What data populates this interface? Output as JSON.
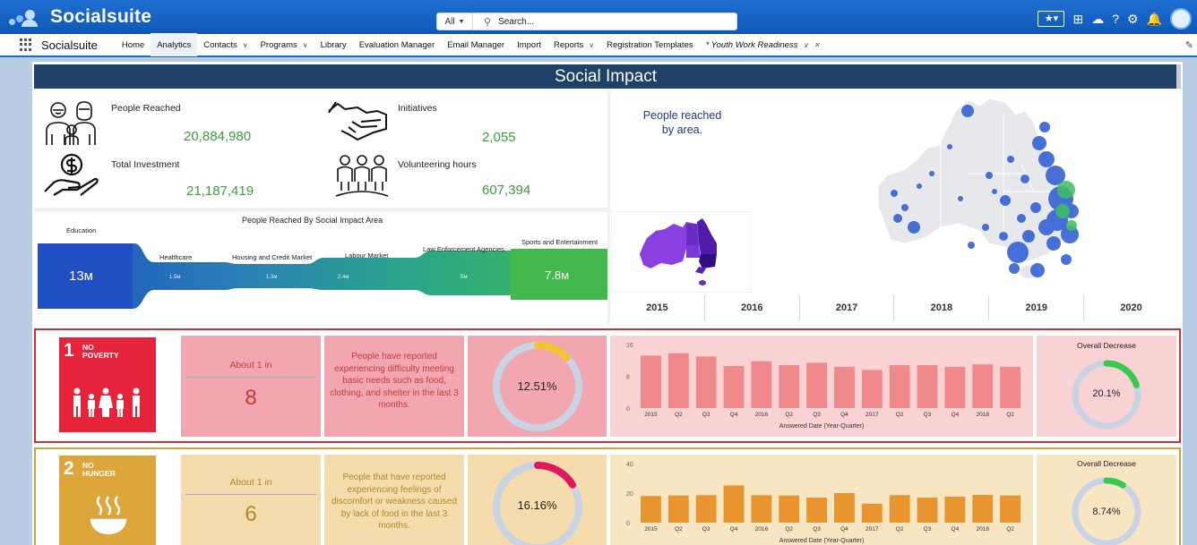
{
  "header": {
    "brand": "Socialsuite",
    "search_scope": "All",
    "search_placeholder": "Search..."
  },
  "nav": {
    "app_name": "Socialsuite",
    "items": [
      {
        "label": "Home",
        "dropdown": false
      },
      {
        "label": "Analytics",
        "dropdown": false,
        "active": true
      },
      {
        "label": "Contacts",
        "dropdown": true
      },
      {
        "label": "Programs",
        "dropdown": true
      },
      {
        "label": "Library",
        "dropdown": false
      },
      {
        "label": "Evaluation Manager",
        "dropdown": false
      },
      {
        "label": "Email Manager",
        "dropdown": false
      },
      {
        "label": "Import",
        "dropdown": false
      },
      {
        "label": "Reports",
        "dropdown": true
      },
      {
        "label": "Registration Templates",
        "dropdown": false
      }
    ],
    "open_tab": "* Youth Work Readiness"
  },
  "dashboard": {
    "title": "Social Impact",
    "metrics": {
      "people_reached": {
        "label": "People Reached",
        "value": "20,884,980"
      },
      "initiatives": {
        "label": "Initiatives",
        "value": "2,055"
      },
      "total_investment": {
        "label": "Total Investment",
        "value": "21,187,419"
      },
      "volunteering_hours": {
        "label": "Volunteering hours",
        "value": "607,394"
      }
    },
    "flow": {
      "title": "People Reached By Social Impact Area",
      "areas": [
        {
          "name": "Education",
          "value": "13м"
        },
        {
          "name": "Healthcare",
          "value": "1.5м"
        },
        {
          "name": "Housing and Credit Market",
          "value": "1.3м"
        },
        {
          "name": "Labour Market",
          "value": "2.4м"
        },
        {
          "name": "Law Enforcement Agencies",
          "value": "5м"
        },
        {
          "name": "Sports and Entertainment",
          "value": "7.8м"
        }
      ]
    },
    "map": {
      "label_line1": "People reached",
      "label_line2": "by area.",
      "years": [
        "2015",
        "2016",
        "2017",
        "2018",
        "2019",
        "2020"
      ]
    }
  },
  "goals": [
    {
      "sdg_number": "1",
      "sdg_name_line1": "NO",
      "sdg_name_line2": "POVERTY",
      "about_label": "About 1 in",
      "about_value": "8",
      "description": "People have reported experiencing difficulty meeting basic needs such as food, clothing, and shelter in the last 3 months.",
      "percent": "12.51%",
      "percent_value": 12.51,
      "chart_data": {
        "type": "bar",
        "categories": [
          "2015",
          "Q2",
          "Q3",
          "Q4",
          "2016",
          "Q2",
          "Q3",
          "Q4",
          "2017",
          "Q2",
          "Q3",
          "Q4",
          "2018",
          "Q2"
        ],
        "values": [
          13.2,
          13.8,
          13.0,
          10.6,
          11.8,
          10.8,
          11.4,
          10.4,
          9.6,
          10.8,
          10.8,
          10.4,
          11.0,
          10.4
        ],
        "xlabel": "Answered Date (Year-Quarter)",
        "y_ticks": [
          "16",
          "8",
          "0"
        ],
        "ylim": [
          0,
          16
        ]
      },
      "overall_label": "Overall Decrease",
      "overall_value": "20.1%",
      "overall_fraction": 0.201
    },
    {
      "sdg_number": "2",
      "sdg_name_line1": "NO",
      "sdg_name_line2": "HUNGER",
      "about_label": "About 1 in",
      "about_value": "6",
      "description": "People that have reported experiencing feelings of discomfort or weakness caused by lack of food in the last 3 months.",
      "percent": "16.16%",
      "percent_value": 16.16,
      "chart_data": {
        "type": "bar",
        "categories": [
          "2015",
          "Q2",
          "Q3",
          "Q4",
          "2016",
          "Q2",
          "Q3",
          "Q4",
          "2017",
          "Q2",
          "Q3",
          "Q4",
          "2018",
          "Q2"
        ],
        "values": [
          18.0,
          18.4,
          18.6,
          25.2,
          18.6,
          18.4,
          17.0,
          20.0,
          12.8,
          18.6,
          17.0,
          17.6,
          18.8,
          18.4
        ],
        "xlabel": "Answered Date (Year-Quarter)",
        "y_ticks": [
          "40",
          "20",
          "0"
        ],
        "ylim": [
          0,
          40
        ]
      },
      "overall_label": "Overall Decrease",
      "overall_value": "8.74%",
      "overall_fraction": 0.0874
    }
  ],
  "colors": {
    "header_blue": "#0e57b8",
    "title_bar": "#1e4167",
    "metric_green": "#3c9d3c",
    "goal1_red": "#e5243b",
    "goal1_bar": "#f0898b",
    "goal1_accent": "#f4c430",
    "goal2_yellow": "#dda63a",
    "goal2_bar": "#e8952f",
    "goal2_accent": "#e0195a",
    "donut_track": "#c9d3e4",
    "overall_green": "#38c94f"
  }
}
